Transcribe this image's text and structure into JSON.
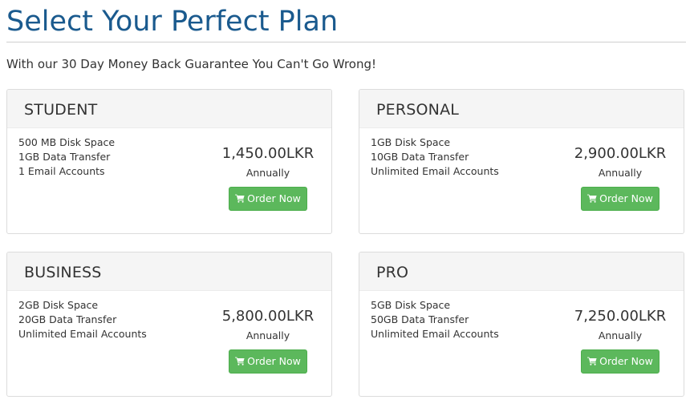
{
  "page": {
    "title": "Select Your Perfect Plan",
    "tagline": "With our 30 Day Money Back Guarantee You Can't Go Wrong!"
  },
  "colors": {
    "title": "#1a5a8e",
    "order_button": "#5cb85c",
    "card_header": "#f5f5f5"
  },
  "plans": [
    {
      "name": "STUDENT",
      "features": [
        "500 MB Disk Space",
        "1GB Data Transfer",
        "1 Email Accounts"
      ],
      "price": "1,450.00LKR",
      "period": "Annually",
      "button_label": "Order Now",
      "button_icon": "shopping-cart-icon"
    },
    {
      "name": "PERSONAL",
      "features": [
        "1GB Disk Space",
        "10GB Data Transfer",
        "Unlimited Email Accounts"
      ],
      "price": "2,900.00LKR",
      "period": "Annually",
      "button_label": "Order Now",
      "button_icon": "shopping-cart-icon"
    },
    {
      "name": "BUSINESS",
      "features": [
        "2GB Disk Space",
        "20GB Data Transfer",
        "Unlimited Email Accounts"
      ],
      "price": "5,800.00LKR",
      "period": "Annually",
      "button_label": "Order Now",
      "button_icon": "shopping-cart-icon"
    },
    {
      "name": "PRO",
      "features": [
        "5GB Disk Space",
        "50GB Data Transfer",
        "Unlimited Email Accounts"
      ],
      "price": "7,250.00LKR",
      "period": "Annually",
      "button_label": "Order Now",
      "button_icon": "shopping-cart-icon"
    }
  ]
}
